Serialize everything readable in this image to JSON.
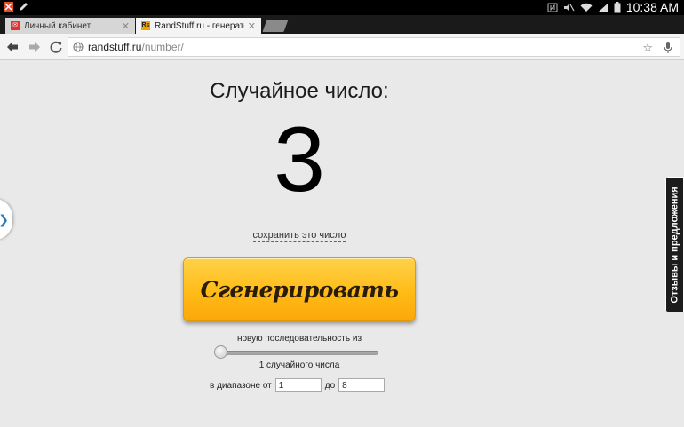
{
  "status_bar": {
    "time": "10:38 AM",
    "icons": [
      "notification-icon",
      "pen-icon",
      "nfc-icon",
      "mute-icon",
      "wifi-icon",
      "signal-icon",
      "battery-icon"
    ]
  },
  "tabs": [
    {
      "label": "Личный кабинет",
      "favicon": "mail-favicon",
      "active": false
    },
    {
      "label": "RandStuff.ru - генератор",
      "favicon": "rs-favicon",
      "active": true
    }
  ],
  "toolbar": {
    "url_host": "randstuff.ru",
    "url_path": "/number/"
  },
  "page": {
    "heading": "Случайное число:",
    "number": "3",
    "save_link": "сохранить это число",
    "generate_button": "Сгенерировать",
    "sequence_label": "новую последовательность из",
    "count_label": "1 случайного числа",
    "slider_value": 0,
    "range_from_label": "в диапазоне от",
    "range_from": "1",
    "range_to_label": "до",
    "range_to": "8"
  },
  "feedback_tab": "Отзывы и предложения",
  "colors": {
    "button": "#ffbb16",
    "link_underline": "#cc3333",
    "side_arrow": "#2b7dbd"
  }
}
